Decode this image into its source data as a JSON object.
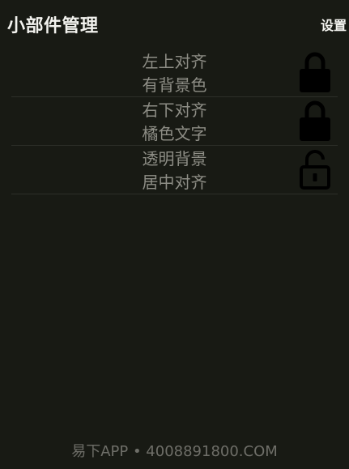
{
  "header": {
    "title": "小部件管理",
    "settings_label": "设置"
  },
  "widgets": [
    {
      "line1": "左上对齐",
      "line2": "有背景色",
      "lock_state": "locked",
      "icon": "lock-icon"
    },
    {
      "line1": "右下对齐",
      "line2": "橘色文字",
      "lock_state": "locked",
      "icon": "lock-icon"
    },
    {
      "line1": "透明背景",
      "line2": "居中对齐",
      "lock_state": "unlocked",
      "icon": "unlock-icon"
    }
  ],
  "footer": {
    "text": "易下APP • 4008891800.COM"
  },
  "colors": {
    "background": "#181a14",
    "title": "#f2f2ee",
    "row_text": "#8e8e86",
    "divider": "#2c2e28",
    "lock": "#000000",
    "footer": "#6e6e68"
  }
}
